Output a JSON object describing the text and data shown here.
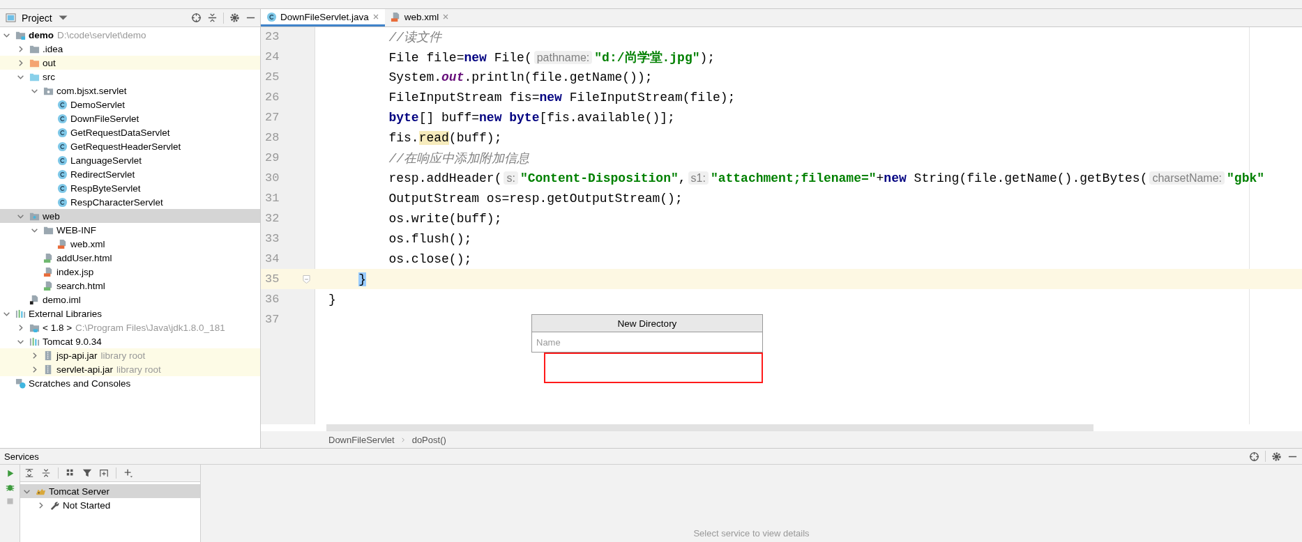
{
  "project_panel": {
    "title": "Project",
    "tree": [
      {
        "label": "demo",
        "hint": "D:\\code\\servlet\\demo",
        "kind": "project",
        "expanded": true,
        "selected": false,
        "highlighted": false,
        "children": [
          {
            "label": ".idea",
            "kind": "folder",
            "expanded": false,
            "selected": false,
            "highlighted": false
          },
          {
            "label": "out",
            "kind": "excluded-folder",
            "expanded": false,
            "selected": false,
            "highlighted": true
          },
          {
            "label": "src",
            "kind": "source-folder",
            "expanded": true,
            "selected": false,
            "highlighted": false,
            "children": [
              {
                "label": "com.bjsxt.servlet",
                "kind": "package",
                "expanded": true,
                "selected": false,
                "highlighted": false,
                "children": [
                  {
                    "label": "DemoServlet",
                    "kind": "class",
                    "selected": false,
                    "highlighted": false
                  },
                  {
                    "label": "DownFileServlet",
                    "kind": "class",
                    "selected": false,
                    "highlighted": false
                  },
                  {
                    "label": "GetRequestDataServlet",
                    "kind": "class",
                    "selected": false,
                    "highlighted": false
                  },
                  {
                    "label": "GetRequestHeaderServlet",
                    "kind": "class",
                    "selected": false,
                    "highlighted": false
                  },
                  {
                    "label": "LanguageServlet",
                    "kind": "class",
                    "selected": false,
                    "highlighted": false
                  },
                  {
                    "label": "RedirectServlet",
                    "kind": "class",
                    "selected": false,
                    "highlighted": false
                  },
                  {
                    "label": "RespByteServlet",
                    "kind": "class",
                    "selected": false,
                    "highlighted": false
                  },
                  {
                    "label": "RespCharacterServlet",
                    "kind": "class",
                    "selected": false,
                    "highlighted": false
                  }
                ]
              }
            ]
          },
          {
            "label": "web",
            "kind": "web-folder",
            "expanded": true,
            "selected": true,
            "highlighted": false,
            "children": [
              {
                "label": "WEB-INF",
                "kind": "folder",
                "expanded": true,
                "selected": false,
                "highlighted": false,
                "children": [
                  {
                    "label": "web.xml",
                    "kind": "xml",
                    "selected": false,
                    "highlighted": false
                  }
                ]
              },
              {
                "label": "addUser.html",
                "kind": "html",
                "selected": false,
                "highlighted": false
              },
              {
                "label": "index.jsp",
                "kind": "jsp",
                "selected": false,
                "highlighted": false
              },
              {
                "label": "search.html",
                "kind": "html",
                "selected": false,
                "highlighted": false
              }
            ]
          },
          {
            "label": "demo.iml",
            "kind": "iml",
            "selected": false,
            "highlighted": false
          }
        ]
      },
      {
        "label": "External Libraries",
        "kind": "libraries",
        "expanded": true,
        "selected": false,
        "highlighted": false,
        "children": [
          {
            "label": "< 1.8 >",
            "hint": "C:\\Program Files\\Java\\jdk1.8.0_181",
            "kind": "jdk",
            "expanded": false,
            "selected": false,
            "highlighted": false
          },
          {
            "label": "Tomcat 9.0.34",
            "kind": "libraries",
            "expanded": true,
            "selected": false,
            "highlighted": false,
            "children": [
              {
                "label": "jsp-api.jar",
                "hint": "library root",
                "kind": "jar",
                "expanded": false,
                "selected": false,
                "highlighted": true
              },
              {
                "label": "servlet-api.jar",
                "hint": "library root",
                "kind": "jar",
                "expanded": false,
                "selected": false,
                "highlighted": true
              }
            ]
          }
        ]
      },
      {
        "label": "Scratches and Consoles",
        "kind": "scratches",
        "selected": false,
        "highlighted": false
      }
    ]
  },
  "editor": {
    "tabs": [
      {
        "label": "DownFileServlet.java",
        "kind": "class",
        "selected": true
      },
      {
        "label": "web.xml",
        "kind": "xml",
        "selected": false
      }
    ],
    "lines": [
      {
        "number": "23",
        "current": false,
        "tokens": [
          {
            "kind": "comment",
            "text": "        //读文件"
          }
        ]
      },
      {
        "number": "24",
        "current": false,
        "tokens": [
          {
            "kind": "plain",
            "text": "        File file="
          },
          {
            "kind": "keyword",
            "text": "new"
          },
          {
            "kind": "plain",
            "text": " File("
          },
          {
            "kind": "hint",
            "text": "pathname:"
          },
          {
            "kind": "string",
            "text": "\"d:/尚学堂.jpg\""
          },
          {
            "kind": "plain",
            "text": ");"
          }
        ]
      },
      {
        "number": "25",
        "current": false,
        "tokens": [
          {
            "kind": "plain",
            "text": "        System."
          },
          {
            "kind": "static",
            "text": "out"
          },
          {
            "kind": "plain",
            "text": ".println(file.getName());"
          }
        ]
      },
      {
        "number": "26",
        "current": false,
        "tokens": [
          {
            "kind": "plain",
            "text": "        FileInputStream fis="
          },
          {
            "kind": "keyword",
            "text": "new"
          },
          {
            "kind": "plain",
            "text": " FileInputStream(file);"
          }
        ]
      },
      {
        "number": "27",
        "current": false,
        "tokens": [
          {
            "kind": "keyword",
            "text": "        byte"
          },
          {
            "kind": "plain",
            "text": "[] buff="
          },
          {
            "kind": "keyword",
            "text": "new byte"
          },
          {
            "kind": "plain",
            "text": "[fis.available()];"
          }
        ]
      },
      {
        "number": "28",
        "current": false,
        "tokens": [
          {
            "kind": "plain",
            "text": "        fis."
          },
          {
            "kind": "usage",
            "text": "read"
          },
          {
            "kind": "plain",
            "text": "(buff);"
          }
        ]
      },
      {
        "number": "29",
        "current": false,
        "tokens": [
          {
            "kind": "comment",
            "text": "        //在响应中添加附加信息"
          }
        ]
      },
      {
        "number": "30",
        "current": false,
        "tokens": [
          {
            "kind": "plain",
            "text": "        resp.addHeader("
          },
          {
            "kind": "hint",
            "text": "s:"
          },
          {
            "kind": "string",
            "text": "\"Content-Disposition\""
          },
          {
            "kind": "plain",
            "text": ","
          },
          {
            "kind": "hint",
            "text": "s1:"
          },
          {
            "kind": "string",
            "text": "\"attachment;filename=\""
          },
          {
            "kind": "plain",
            "text": "+"
          },
          {
            "kind": "keyword",
            "text": "new"
          },
          {
            "kind": "plain",
            "text": " String(file.getName().getBytes("
          },
          {
            "kind": "hint",
            "text": "charsetName:"
          },
          {
            "kind": "string",
            "text": "\"gbk\""
          }
        ]
      },
      {
        "number": "31",
        "current": false,
        "tokens": [
          {
            "kind": "plain",
            "text": "        OutputStream os=resp.getOutputStream();"
          }
        ]
      },
      {
        "number": "32",
        "current": false,
        "tokens": [
          {
            "kind": "plain",
            "text": "        os.write(buff);"
          }
        ]
      },
      {
        "number": "33",
        "current": false,
        "tokens": [
          {
            "kind": "plain",
            "text": "        os.flush();"
          }
        ]
      },
      {
        "number": "34",
        "current": false,
        "tokens": [
          {
            "kind": "plain",
            "text": "        os.close();"
          }
        ]
      },
      {
        "number": "35",
        "current": true,
        "tokens": [
          {
            "kind": "brace",
            "text": "    }"
          }
        ]
      },
      {
        "number": "36",
        "current": false,
        "tokens": [
          {
            "kind": "plain",
            "text": "}"
          }
        ]
      },
      {
        "number": "37",
        "current": false
      }
    ],
    "breadcrumbs": [
      "DownFileServlet",
      "doPost()"
    ]
  },
  "popup": {
    "title": "New Directory",
    "name_field": {
      "placeholder": "Name"
    }
  },
  "services": {
    "title": "Services",
    "tree": [
      {
        "label": "Tomcat Server",
        "kind": "server",
        "expanded": true,
        "selected": true,
        "children": [
          {
            "label": "Not Started",
            "kind": "wrench",
            "expanded": false,
            "selected": false
          }
        ]
      }
    ],
    "detail_hint": "Select service to view details"
  }
}
